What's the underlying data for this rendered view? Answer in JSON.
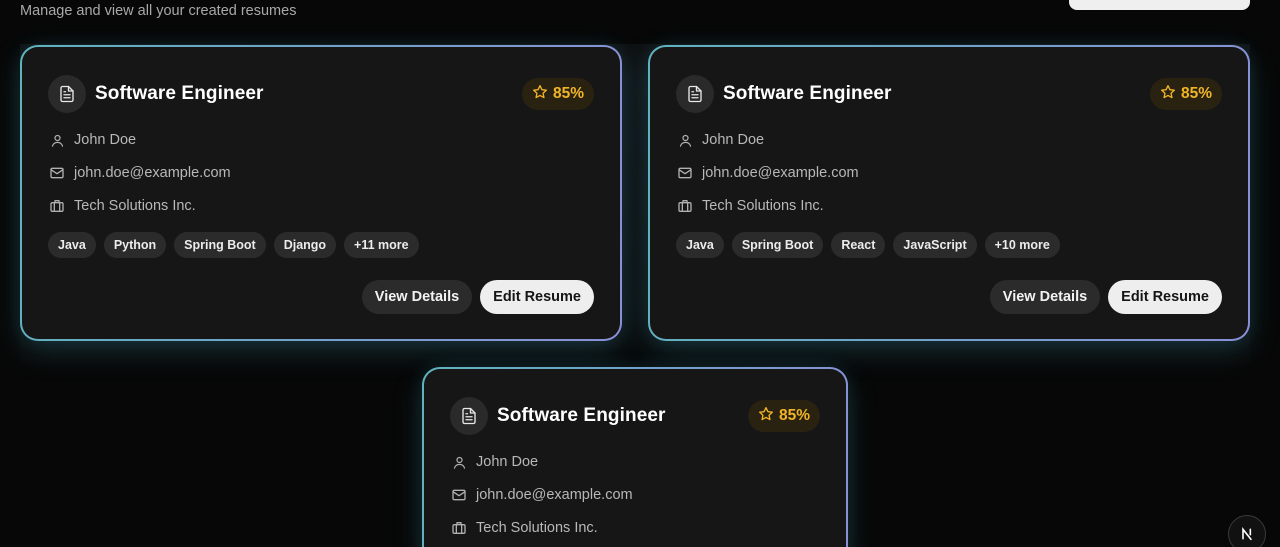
{
  "header": {
    "subtitle": "Manage and view all your created resumes"
  },
  "colors": {
    "score": "#f0b429",
    "card_border_from": "#5fb3bd",
    "card_border_to": "#8a8fd6",
    "card_bg": "#161616",
    "edit_button_bg": "#eeeeee"
  },
  "icons": {
    "title": "document-icon",
    "score": "star-icon",
    "name": "user-icon",
    "email": "mail-icon",
    "company": "briefcase-icon",
    "corner": "next-logo-icon"
  },
  "resumes": [
    {
      "title": "Software Engineer",
      "score": "85%",
      "name": "John Doe",
      "email": "john.doe@example.com",
      "company": "Tech Solutions Inc.",
      "skills": [
        "Java",
        "Python",
        "Spring Boot",
        "Django"
      ],
      "more": "+11 more",
      "view_label": "View Details",
      "edit_label": "Edit Resume"
    },
    {
      "title": "Software Engineer",
      "score": "85%",
      "name": "John Doe",
      "email": "john.doe@example.com",
      "company": "Tech Solutions Inc.",
      "skills": [
        "Java",
        "Spring Boot",
        "React",
        "JavaScript"
      ],
      "more": "+10 more",
      "view_label": "View Details",
      "edit_label": "Edit Resume"
    },
    {
      "title": "Software Engineer",
      "score": "85%",
      "name": "John Doe",
      "email": "john.doe@example.com",
      "company": "Tech Solutions Inc."
    }
  ],
  "corner_badge": "N"
}
